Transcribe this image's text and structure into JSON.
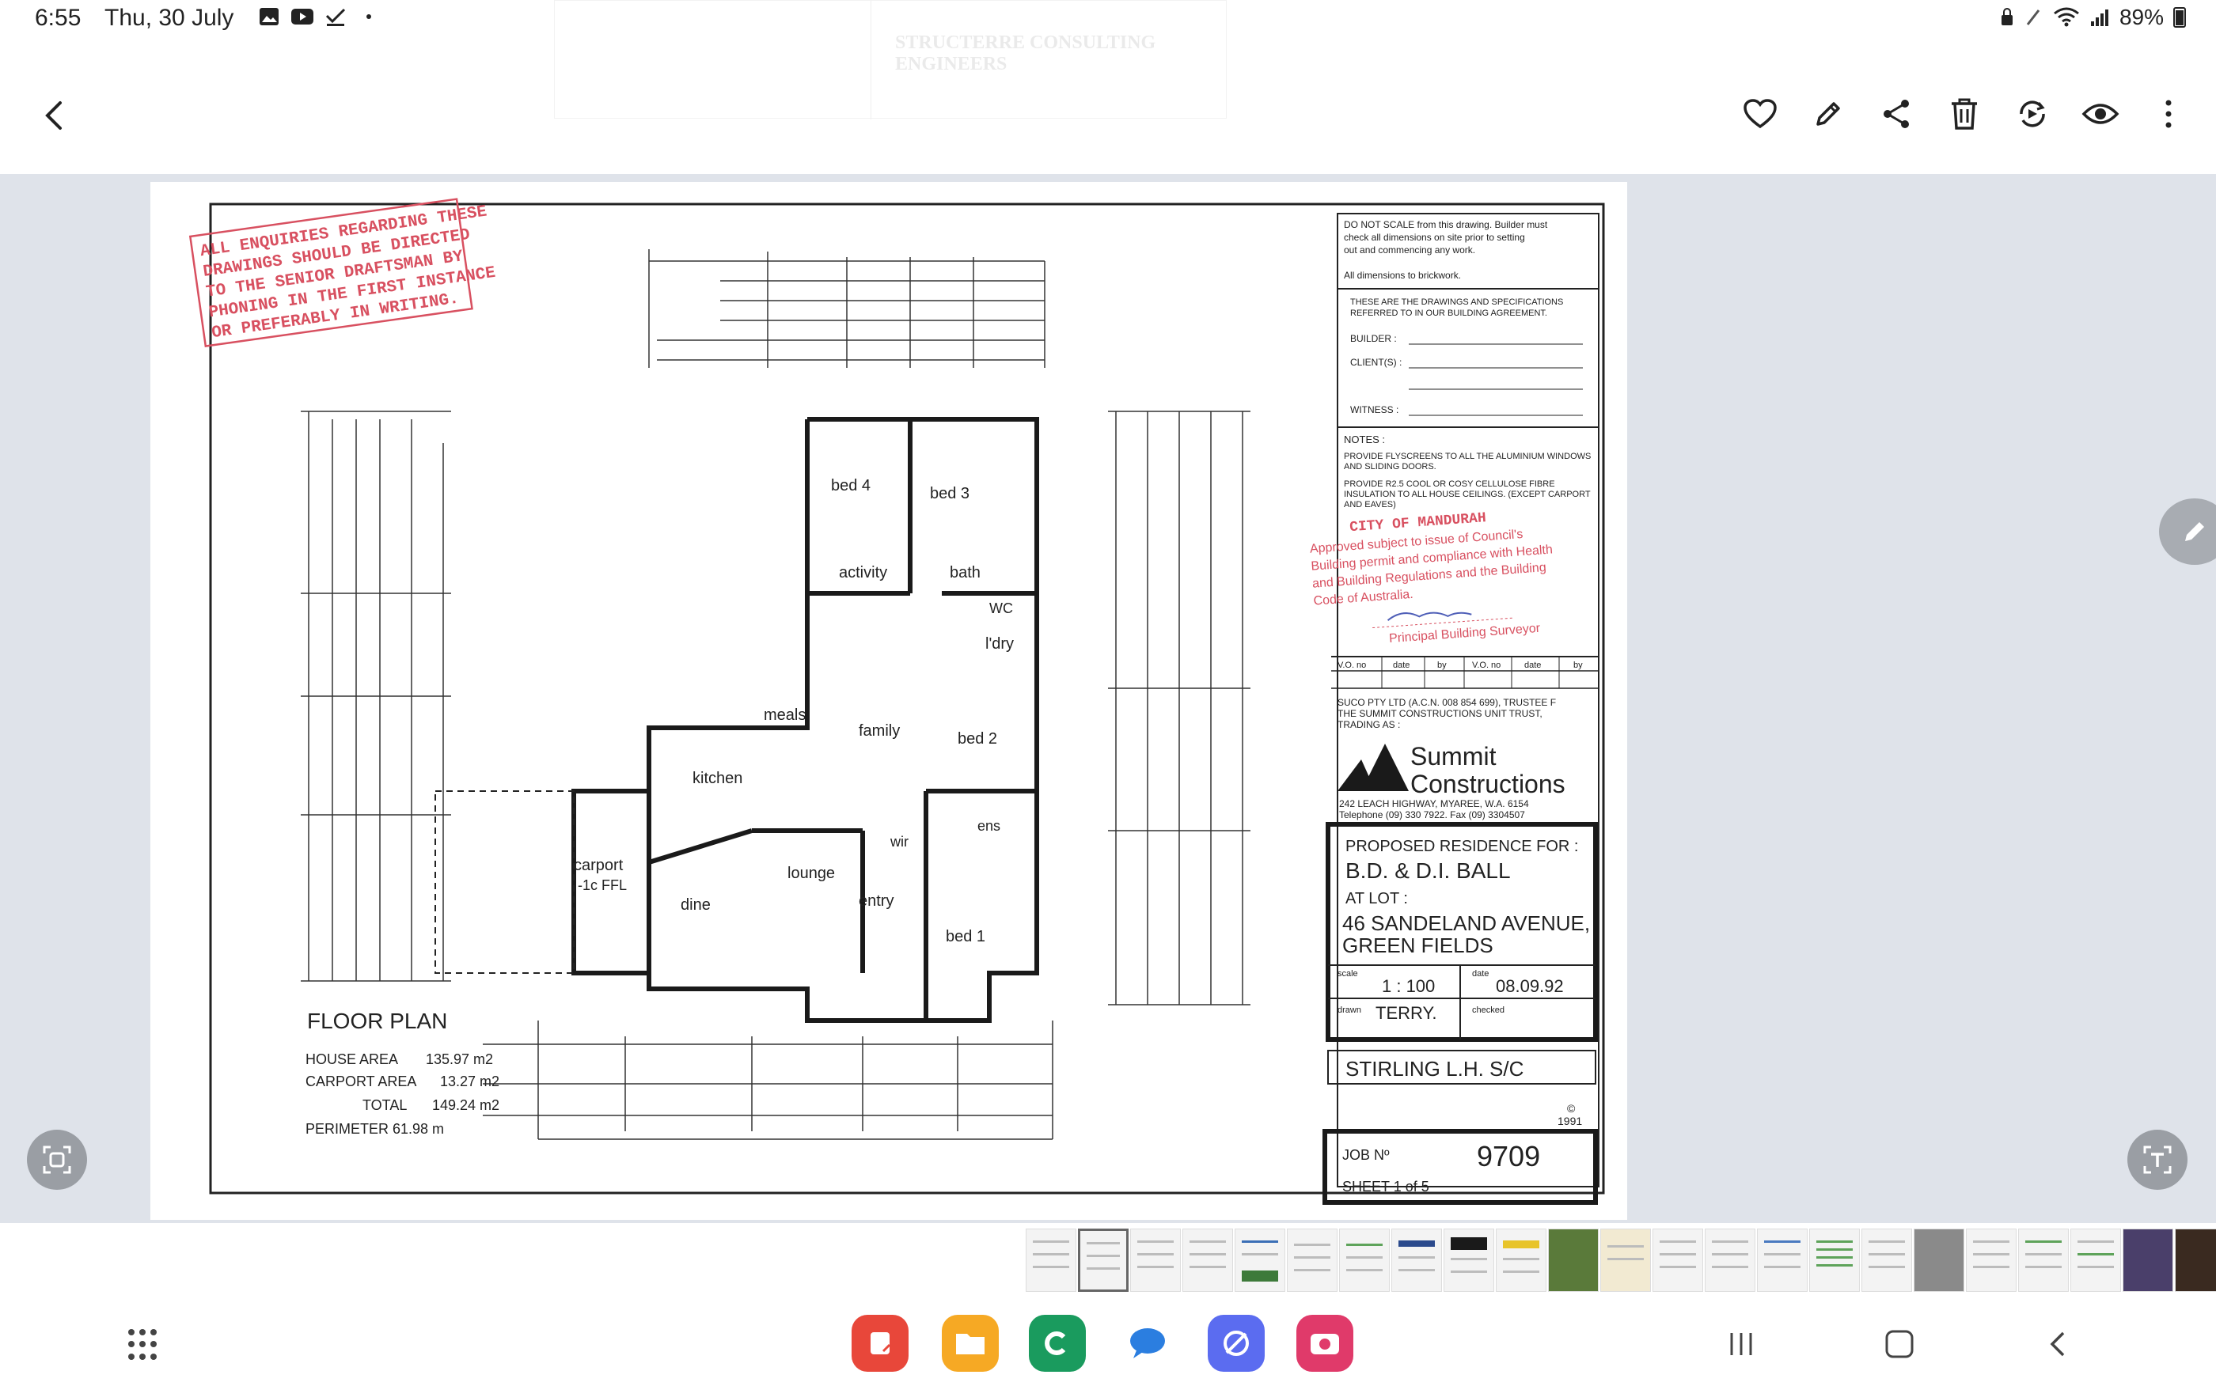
{
  "status_bar": {
    "time": "6:55",
    "date": "Thu, 30 July",
    "battery": "89%",
    "icons": [
      "gallery-icon",
      "youtube-icon",
      "checkmark-icon",
      "dot-icon"
    ]
  },
  "toolbar": {
    "back": "back-icon",
    "actions": [
      "heart-icon",
      "edit-icon",
      "share-icon",
      "delete-icon",
      "remaster-icon",
      "view-icon",
      "more-icon"
    ]
  },
  "document": {
    "stamp": [
      "ALL ENQUIRIES REGARDING THESE",
      "DRAWINGS SHOULD BE DIRECTED",
      "TO THE SENIOR DRAFTSMAN BY",
      "PHONING IN THE FIRST INSTANCE",
      "OR PREFERABLY IN WRITING."
    ],
    "notes_top": [
      "DO NOT SCALE from this drawing. Builder must",
      "check all dimensions on site prior to setting",
      "out and commencing any work."
    ],
    "dimensions_note": "All dimensions to brickwork.",
    "agreement": [
      "THESE ARE THE DRAWINGS AND SPECIFICATIONS",
      "REFERRED TO IN OUR BUILDING AGREEMENT."
    ],
    "builder_label": "BUILDER :",
    "clients_label": "CLIENT(S) :",
    "witness_label": "WITNESS :",
    "notes_label": "NOTES :",
    "notes": [
      "PROVIDE FLYSCREENS TO ALL THE ALUMINIUM WINDOWS",
      "AND SLIDING DOORS.",
      "PROVIDE R2.5 COOL OR COSY CELLULOSE FIBRE",
      "INSULATION TO ALL HOUSE CEILINGS. (EXCEPT CARPORT",
      "AND EAVES)"
    ],
    "council_stamp": [
      "CITY OF MANDURAH",
      "Approved subject to issue of Council's",
      "Building permit and compliance with Health",
      "and Building Regulations and the Building",
      "Code of Australia.",
      "Principal Building Surveyor"
    ],
    "vo_headers": [
      "V.O. no",
      "date",
      "by",
      "V.O. no",
      "date",
      "by"
    ],
    "company_line": [
      "SUCO PTY LTD (A.C.N. 008 854 699), TRUSTEE F",
      "THE SUMMIT CONSTRUCTIONS UNIT TRUST,",
      "TRADING AS :"
    ],
    "company_name": [
      "Summit",
      "Constructions"
    ],
    "company_address": [
      "242 LEACH HIGHWAY, MYAREE, W.A. 6154",
      "Telephone (09) 330 7922. Fax (09) 3304507"
    ],
    "proposed": "PROPOSED RESIDENCE FOR :",
    "client": "B.D. & D.I. BALL",
    "at_lot": "AT LOT :",
    "address": [
      "46 SANDELAND AVENUE,",
      "GREEN FIELDS"
    ],
    "scale_label": "scale",
    "scale": "1 : 100",
    "date_label": "date",
    "date": "08.09.92",
    "drawn_label": "drawn",
    "drawn": "TERRY.",
    "checked_label": "checked",
    "design": "STIRLING L.H. S/C",
    "copyright": "©",
    "year": "1991",
    "job_label": "JOB Nº",
    "job_no": "9709",
    "sheet": "SHEET 1 of 5",
    "floor_plan_title": "FLOOR PLAN",
    "areas": [
      {
        "label": "HOUSE AREA",
        "value": "135.97 m2"
      },
      {
        "label": "CARPORT AREA",
        "value": "13.27 m2"
      },
      {
        "label": "TOTAL",
        "value": "149.24 m2"
      }
    ],
    "perimeter": "PERIMETER 61.98 m",
    "rooms": [
      "bed 4",
      "bed 3",
      "activity",
      "bath",
      "WC",
      "l'dry",
      "meals",
      "family",
      "bed 2",
      "kitchen",
      "ens",
      "wir",
      "lounge",
      "entry",
      "dine",
      "bed 1",
      "carport",
      "-1c FFL"
    ],
    "ghost_title": "STRUCTERRE CONSULTING ENGINEERS"
  },
  "dock": {
    "apps": [
      "notes-app",
      "files-app",
      "phone-app",
      "messages-app",
      "internet-app",
      "camera-app"
    ],
    "nav": [
      "recents-icon",
      "home-icon",
      "back-nav-icon"
    ]
  }
}
